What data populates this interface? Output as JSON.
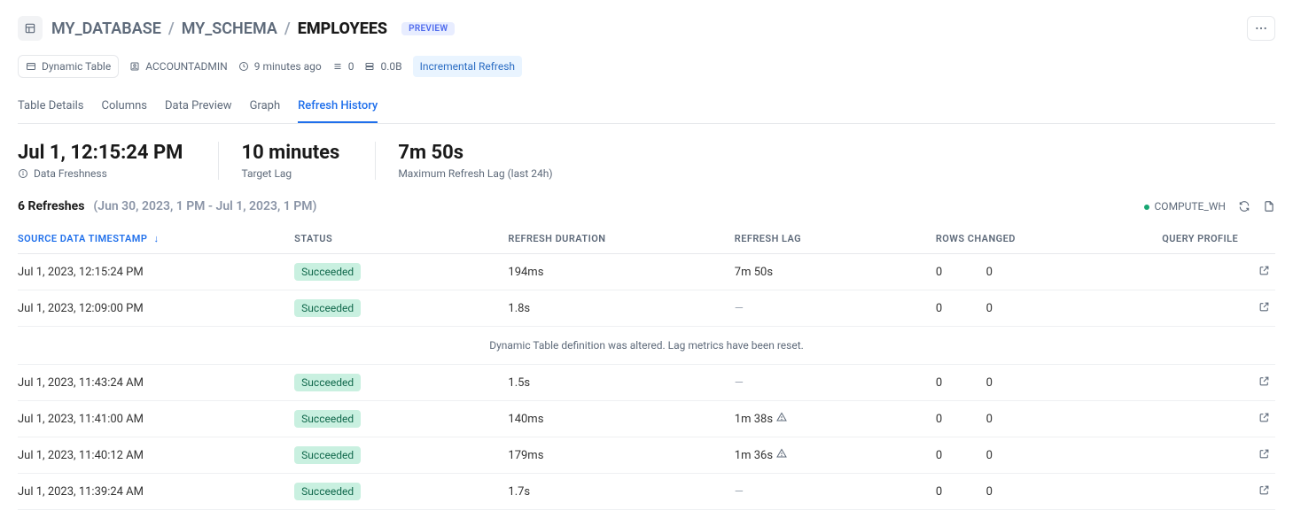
{
  "header": {
    "crumb1": "MY_DATABASE",
    "crumb2": "MY_SCHEMA",
    "crumb3": "EMPLOYEES",
    "preview_badge": "PREVIEW"
  },
  "meta": {
    "type_label": "Dynamic Table",
    "role": "ACCOUNTADMIN",
    "updated": "9 minutes ago",
    "rows": "0",
    "bytes": "0.0B",
    "refresh_mode": "Incremental Refresh"
  },
  "tabs": [
    {
      "label": "Table Details",
      "active": false
    },
    {
      "label": "Columns",
      "active": false
    },
    {
      "label": "Data Preview",
      "active": false
    },
    {
      "label": "Graph",
      "active": false
    },
    {
      "label": "Refresh History",
      "active": true
    }
  ],
  "stats": {
    "freshness_value": "Jul 1, 12:15:24 PM",
    "freshness_label": "Data Freshness",
    "target_lag_value": "10 minutes",
    "target_lag_label": "Target Lag",
    "max_lag_value": "7m 50s",
    "max_lag_label": "Maximum Refresh Lag (last 24h)"
  },
  "list_header": {
    "count_label": "6 Refreshes",
    "range_label": "(Jun 30, 2023, 1 PM - Jul 1, 2023, 1 PM)",
    "wh_label": "COMPUTE_WH"
  },
  "columns": {
    "source_ts": "SOURCE DATA TIMESTAMP",
    "status": "STATUS",
    "duration": "REFRESH DURATION",
    "lag": "REFRESH LAG",
    "rows_changed": "ROWS CHANGED",
    "query_profile": "QUERY PROFILE"
  },
  "rows": [
    {
      "ts": "Jul 1, 2023, 12:15:24 PM",
      "status": "Succeeded",
      "duration": "194ms",
      "lag": "7m 50s",
      "lag_warn": false,
      "col_a": "0",
      "col_b": "0"
    },
    {
      "ts": "Jul 1, 2023, 12:09:00 PM",
      "status": "Succeeded",
      "duration": "1.8s",
      "lag": "—",
      "lag_warn": false,
      "col_a": "0",
      "col_b": "0"
    },
    {
      "notice": "Dynamic Table definition was altered. Lag metrics have been reset."
    },
    {
      "ts": "Jul 1, 2023, 11:43:24 AM",
      "status": "Succeeded",
      "duration": "1.5s",
      "lag": "—",
      "lag_warn": false,
      "col_a": "0",
      "col_b": "0"
    },
    {
      "ts": "Jul 1, 2023, 11:41:00 AM",
      "status": "Succeeded",
      "duration": "140ms",
      "lag": "1m 38s",
      "lag_warn": true,
      "col_a": "0",
      "col_b": "0"
    },
    {
      "ts": "Jul 1, 2023, 11:40:12 AM",
      "status": "Succeeded",
      "duration": "179ms",
      "lag": "1m 36s",
      "lag_warn": true,
      "col_a": "0",
      "col_b": "0"
    },
    {
      "ts": "Jul 1, 2023, 11:39:24 AM",
      "status": "Succeeded",
      "duration": "1.7s",
      "lag": "—",
      "lag_warn": false,
      "col_a": "0",
      "col_b": "0"
    }
  ]
}
